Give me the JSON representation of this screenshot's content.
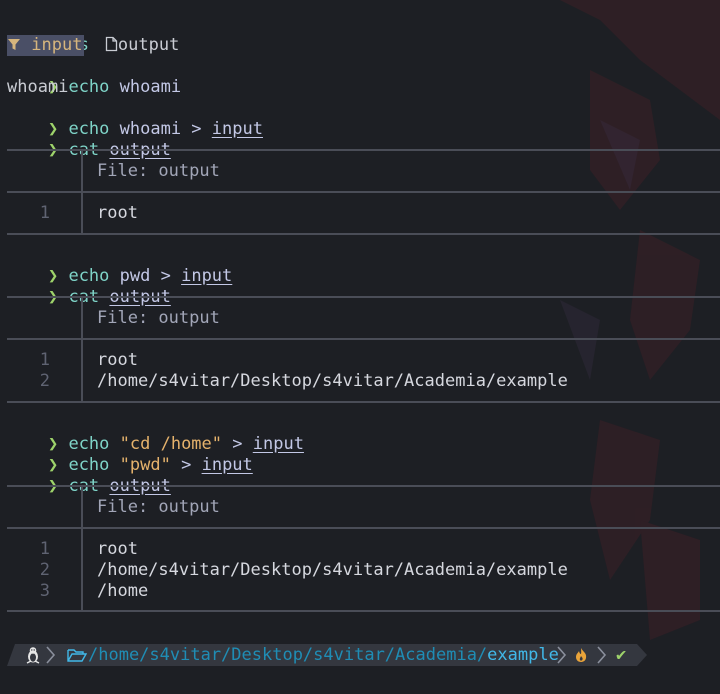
{
  "terminal": {
    "prompt_symbol": "❯",
    "ls_cmd": "ls",
    "ls_entries": [
      {
        "name": "input",
        "icon": "filter-icon"
      },
      {
        "name": "output",
        "icon": "file-icon"
      }
    ],
    "block1": {
      "echo_cmd": "echo",
      "echo_arg": "whoami",
      "echo_output": "whoami",
      "redirect_cmd": "echo",
      "redirect_arg": "whoami >",
      "redirect_file": "input",
      "cat_cmd": "cat",
      "cat_file": "output",
      "header": "File: output",
      "lines": [
        {
          "num": "1",
          "text": "root"
        }
      ]
    },
    "block2": {
      "redirect_cmd": "echo",
      "redirect_arg": "pwd >",
      "redirect_file": "input",
      "cat_cmd": "cat",
      "cat_file": "output",
      "header": "File: output",
      "lines": [
        {
          "num": "1",
          "text": "root"
        },
        {
          "num": "2",
          "text": "/home/s4vitar/Desktop/s4vitar/Academia/example"
        }
      ]
    },
    "block3": {
      "cmd1": "echo",
      "cmd1_string": "\"cd /home\"",
      "cmd1_op": ">",
      "cmd1_file": "input",
      "cmd2": "echo",
      "cmd2_string": "\"pwd\"",
      "cmd2_op": ">",
      "cmd2_file": "input",
      "cat_cmd": "cat",
      "cat_file": "output",
      "header": "File: output",
      "lines": [
        {
          "num": "1",
          "text": "root"
        },
        {
          "num": "2",
          "text": "/home/s4vitar/Desktop/s4vitar/Academia/example"
        },
        {
          "num": "3",
          "text": "/home"
        }
      ]
    }
  },
  "statusbar": {
    "os_icon": "linux-penguin-icon",
    "folder_icon": "folder-open-icon",
    "path_prefix": "/home/s4vitar/Desktop/s4vitar/Academia/",
    "path_current": "example",
    "root_icon": "flame-icon",
    "status_icon": "checkmark-icon",
    "status_glyph": "✔"
  },
  "colors": {
    "background": "#1d1f24",
    "prompt": "#9ed36b",
    "command": "#7fd4c8",
    "string": "#e5b26c",
    "path": "#41b8e8",
    "statusbar": "#34373f"
  }
}
